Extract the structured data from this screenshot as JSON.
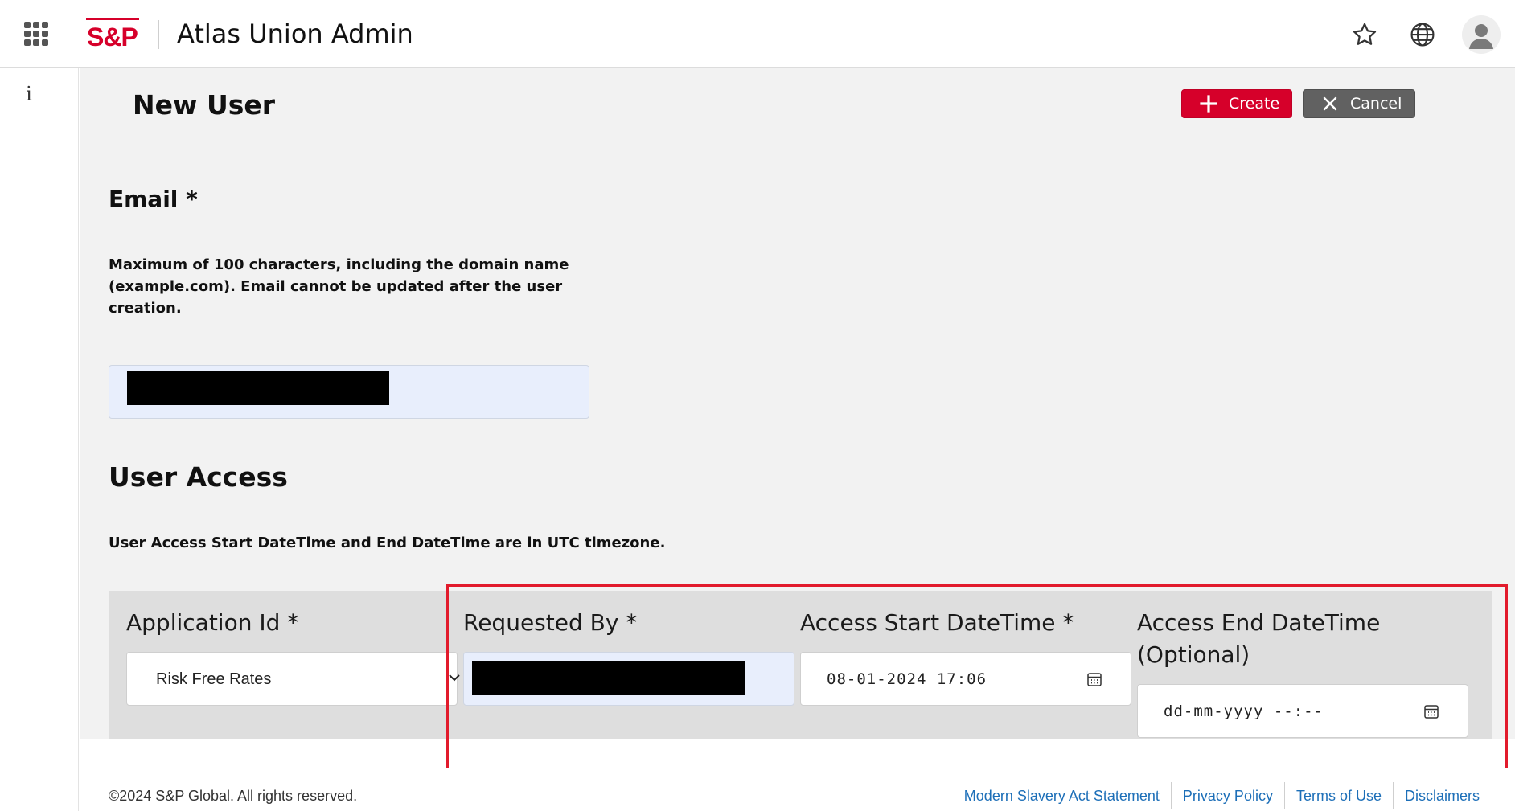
{
  "header": {
    "logo_text": "S&P",
    "app_title": "Atlas Union Admin",
    "icons": [
      "apps-grid-icon",
      "star-icon",
      "globe-icon",
      "user-avatar-icon"
    ]
  },
  "left_rail": {
    "info_label": "i"
  },
  "page": {
    "title": "New User",
    "actions": {
      "create_label": "Create",
      "cancel_label": "Cancel"
    }
  },
  "email_section": {
    "label": "Email *",
    "help_text": "Maximum of 100 characters, including the domain name (example.com). Email cannot be updated after the user creation.",
    "value": "[redacted]"
  },
  "user_access": {
    "label": "User Access",
    "note": "User Access Start DateTime and End DateTime are in UTC timezone.",
    "fields": {
      "application_id": {
        "label": "Application Id *",
        "value": "Risk Free Rates"
      },
      "requested_by": {
        "label": "Requested By *",
        "value": "[redacted]"
      },
      "access_start": {
        "label": "Access Start DateTime *",
        "value": "08-01-2024 17:06"
      },
      "access_end": {
        "label": "Access End DateTime (Optional)",
        "placeholder": "dd-mm-yyyy --:--"
      }
    }
  },
  "footer": {
    "copyright": "©2024 S&P Global. All rights reserved.",
    "links": [
      "Modern Slavery Act Statement",
      "Privacy Policy",
      "Terms of Use",
      "Disclaimers"
    ]
  },
  "colors": {
    "brand_red": "#d6002a",
    "cancel_gray": "#616161",
    "highlight_red": "#e21b2c",
    "link_blue": "#1d6fb8"
  }
}
